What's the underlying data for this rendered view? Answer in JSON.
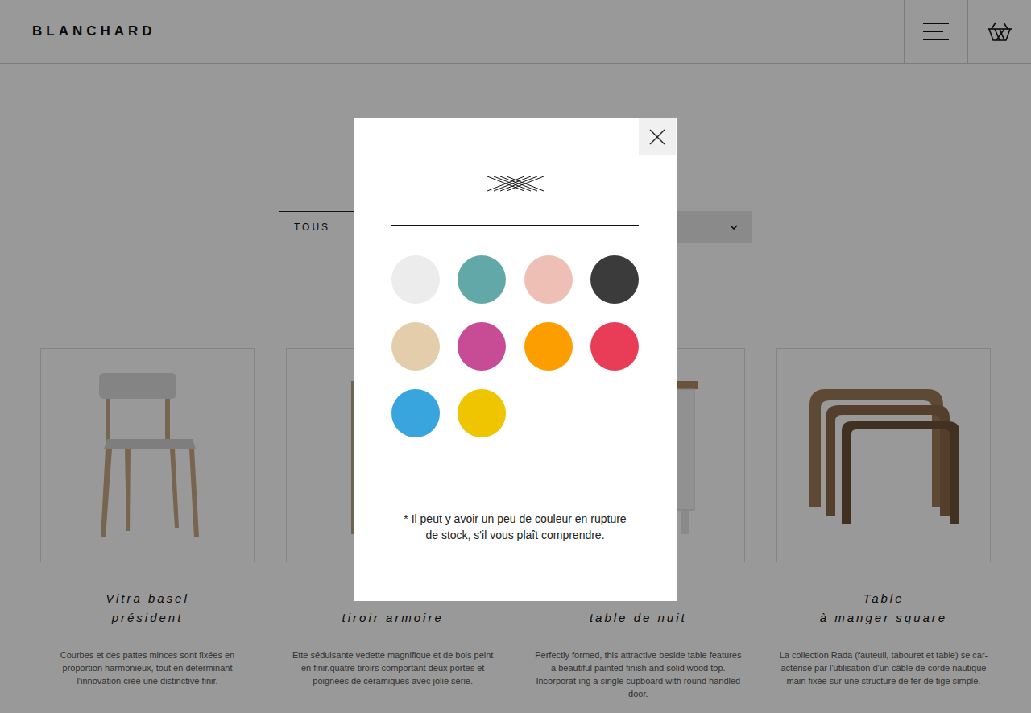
{
  "header": {
    "brand": "BLANCHARD"
  },
  "filter": {
    "tabs": [
      {
        "label": "TOUS",
        "selected": true
      }
    ]
  },
  "products": [
    {
      "title_lines": [
        "Vitra basel",
        "président"
      ],
      "description": "Courbes et des pattes minces sont fixées en proportion harmonieux, tout en déterminant l'innovation crée une distinctive finir."
    },
    {
      "title_lines": [
        "tiroir armoire"
      ],
      "description": "Ette séduisante vedette magnifique et de bois peint en finir.quatre tiroirs comportant deux portes et poignées de céramiques avec jolie série."
    },
    {
      "title_lines": [
        "table de nuit"
      ],
      "description": "Perfectly formed, this attractive beside table features a beautiful painted finish and solid wood top. Incorporat-ing a single cupboard with round handled door."
    },
    {
      "title_lines": [
        "Table",
        "à manger square"
      ],
      "description": "La collection Rada (fauteuil, tabouret et table) se car-actérise par l'utilisation d'un câble de corde nautique main fixée sur une structure de fer de tige simple."
    }
  ],
  "color_picker": {
    "colors": [
      {
        "color": "#ececec",
        "selected": false
      },
      {
        "color": "#62a8a8",
        "selected": false
      },
      {
        "color": "#eebfb5",
        "selected": false
      },
      {
        "color": "#3b3b3b",
        "selected": false
      },
      {
        "color": "#e3cdab",
        "selected": false
      },
      {
        "color": "#c84b96",
        "selected": false
      },
      {
        "color": "#fd9e00",
        "selected": false
      },
      {
        "color": "#e93d57",
        "selected": false
      },
      {
        "color": "#38a5df",
        "selected": false
      },
      {
        "color": "#eec500",
        "selected": false
      }
    ],
    "note": "* Il peut y avoir un peu de couleur en rupture de stock, s'il vous plaît comprendre."
  }
}
